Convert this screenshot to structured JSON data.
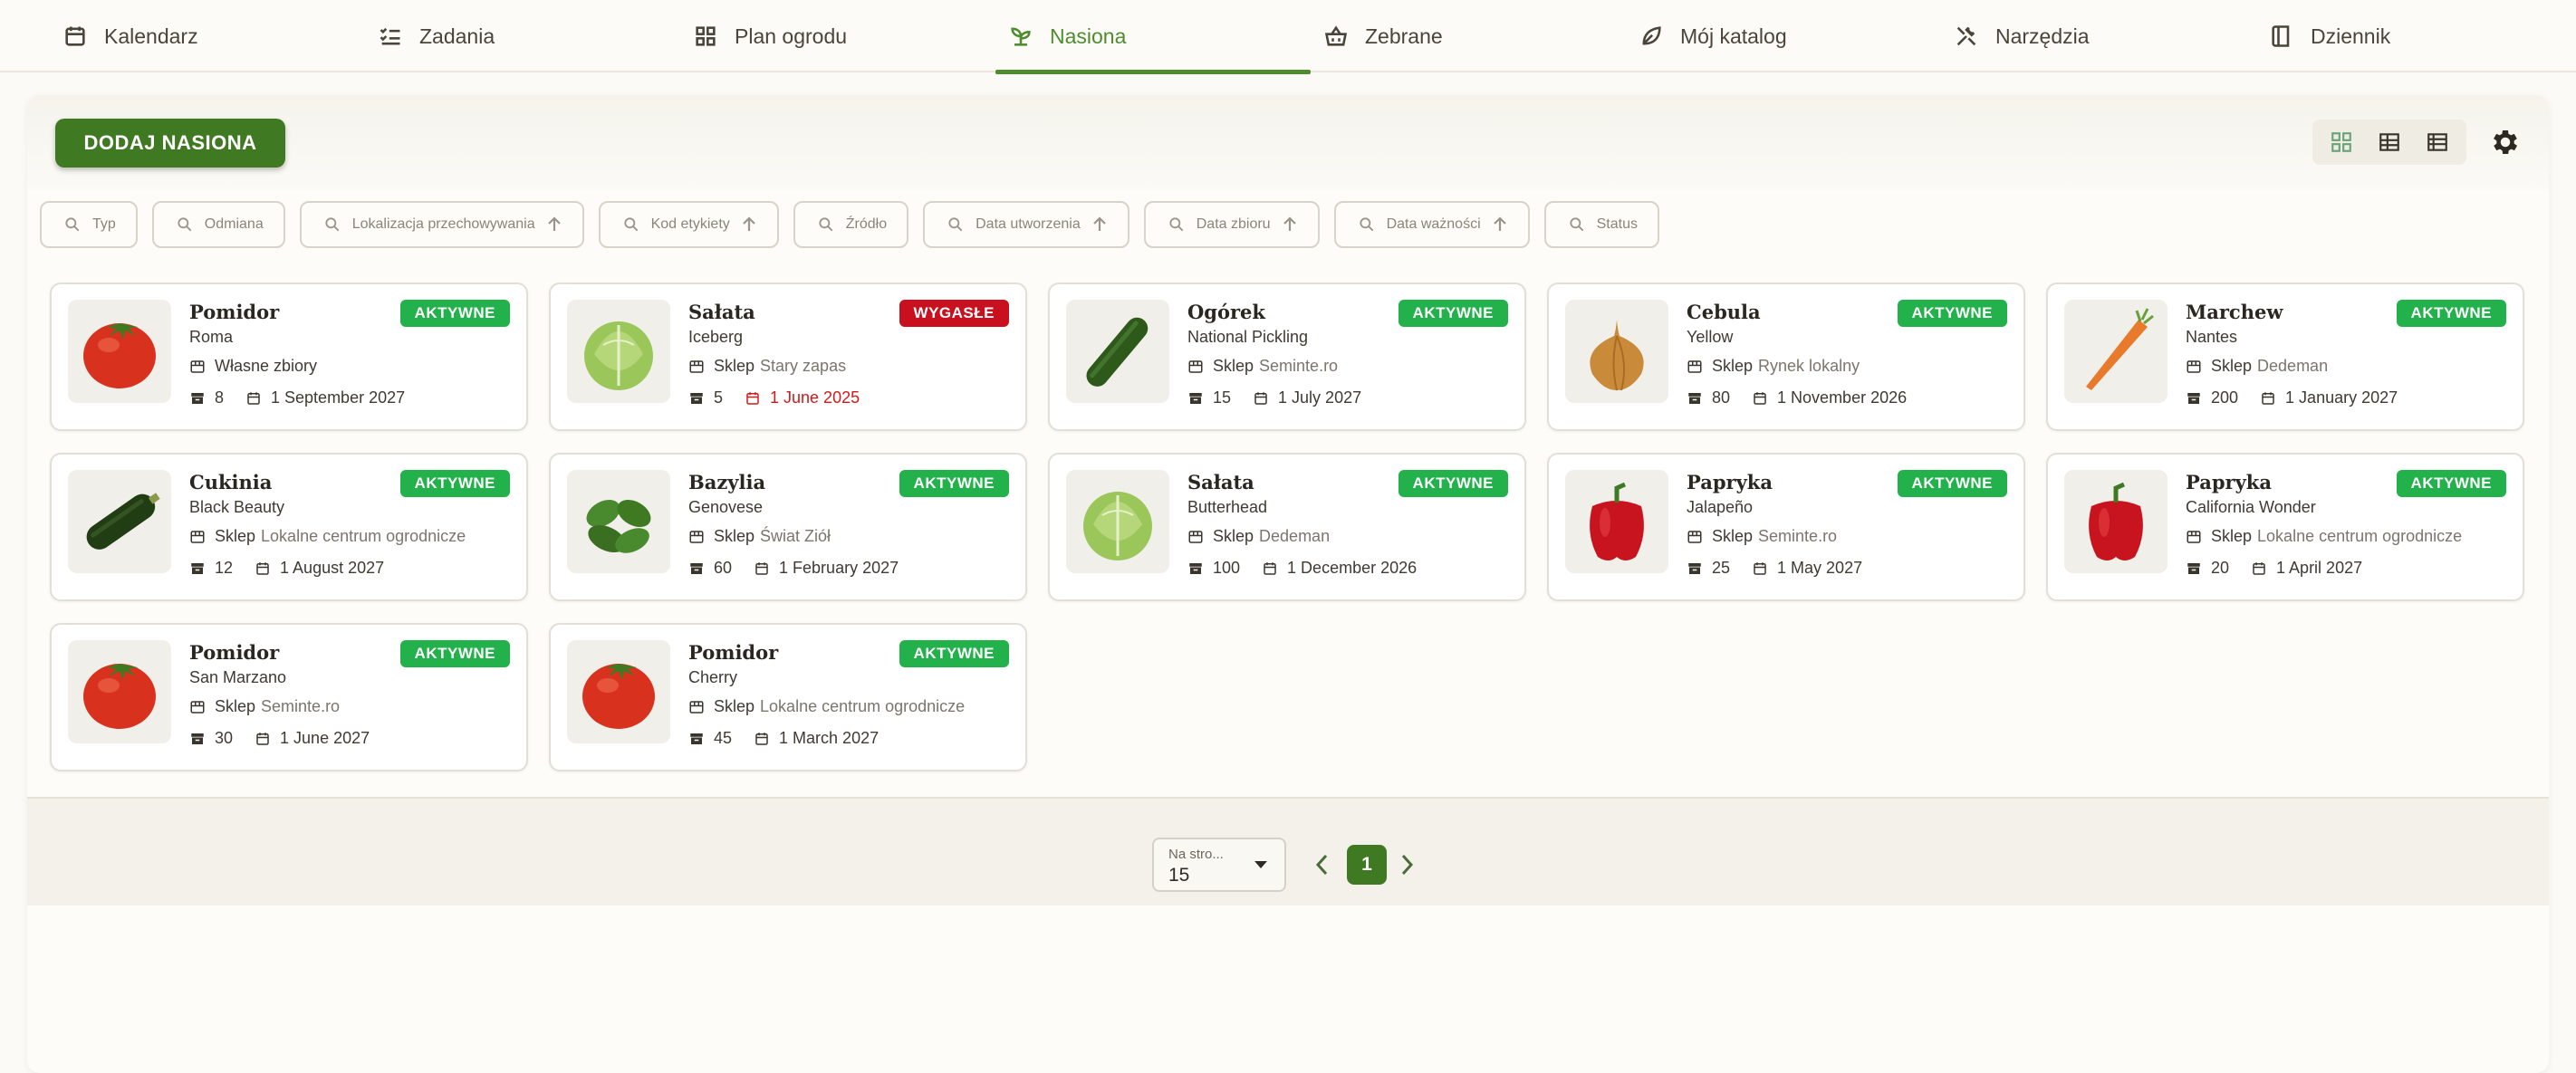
{
  "nav": [
    {
      "label": "Kalendarz",
      "icon": "calendar-icon",
      "active": false
    },
    {
      "label": "Zadania",
      "icon": "checklist-icon",
      "active": false
    },
    {
      "label": "Plan ogrodu",
      "icon": "grid-icon",
      "active": false
    },
    {
      "label": "Nasiona",
      "icon": "sprout-icon",
      "active": true
    },
    {
      "label": "Zebrane",
      "icon": "basket-icon",
      "active": false
    },
    {
      "label": "Mój katalog",
      "icon": "leaf-icon",
      "active": false
    },
    {
      "label": "Narzędzia",
      "icon": "tools-icon",
      "active": false
    },
    {
      "label": "Dziennik",
      "icon": "book-icon",
      "active": false
    }
  ],
  "toolbar": {
    "add_label": "DODAJ NASIONA"
  },
  "filters": [
    {
      "label": "Typ",
      "sortable": false
    },
    {
      "label": "Odmiana",
      "sortable": false
    },
    {
      "label": "Lokalizacja przechowywania",
      "sortable": true
    },
    {
      "label": "Kod etykiety",
      "sortable": true
    },
    {
      "label": "Źródło",
      "sortable": false
    },
    {
      "label": "Data utworzenia",
      "sortable": true
    },
    {
      "label": "Data zbioru",
      "sortable": true
    },
    {
      "label": "Data ważności",
      "sortable": true
    },
    {
      "label": "Status",
      "sortable": false
    }
  ],
  "cards": [
    {
      "name": "Pomidor",
      "variety": "Roma",
      "status": "AKTYWNE",
      "expired": false,
      "source_prefix": "",
      "source": "Własne zbiory",
      "qty": "8",
      "date": "1 September 2027",
      "image": "tomato"
    },
    {
      "name": "Sałata",
      "variety": "Iceberg",
      "status": "WYGASŁE",
      "expired": true,
      "source_prefix": "Sklep",
      "source": "Stary zapas",
      "qty": "5",
      "date": "1 June 2025",
      "image": "lettuce"
    },
    {
      "name": "Ogórek",
      "variety": "National Pickling",
      "status": "AKTYWNE",
      "expired": false,
      "source_prefix": "Sklep",
      "source": "Seminte.ro",
      "qty": "15",
      "date": "1 July 2027",
      "image": "cucumber"
    },
    {
      "name": "Cebula",
      "variety": "Yellow",
      "status": "AKTYWNE",
      "expired": false,
      "source_prefix": "Sklep",
      "source": "Rynek lokalny",
      "qty": "80",
      "date": "1 November 2026",
      "image": "onion"
    },
    {
      "name": "Marchew",
      "variety": "Nantes",
      "status": "AKTYWNE",
      "expired": false,
      "source_prefix": "Sklep",
      "source": "Dedeman",
      "qty": "200",
      "date": "1 January 2027",
      "image": "carrot"
    },
    {
      "name": "Cukinia",
      "variety": "Black Beauty",
      "status": "AKTYWNE",
      "expired": false,
      "source_prefix": "Sklep",
      "source": "Lokalne centrum ogrodnicze",
      "qty": "12",
      "date": "1 August 2027",
      "image": "zucchini"
    },
    {
      "name": "Bazylia",
      "variety": "Genovese",
      "status": "AKTYWNE",
      "expired": false,
      "source_prefix": "Sklep",
      "source": "Świat Ziół",
      "qty": "60",
      "date": "1 February 2027",
      "image": "basil"
    },
    {
      "name": "Sałata",
      "variety": "Butterhead",
      "status": "AKTYWNE",
      "expired": false,
      "source_prefix": "Sklep",
      "source": "Dedeman",
      "qty": "100",
      "date": "1 December 2026",
      "image": "lettuce"
    },
    {
      "name": "Papryka",
      "variety": "Jalapeño",
      "status": "AKTYWNE",
      "expired": false,
      "source_prefix": "Sklep",
      "source": "Seminte.ro",
      "qty": "25",
      "date": "1 May 2027",
      "image": "pepper"
    },
    {
      "name": "Papryka",
      "variety": "California Wonder",
      "status": "AKTYWNE",
      "expired": false,
      "source_prefix": "Sklep",
      "source": "Lokalne centrum ogrodnicze",
      "qty": "20",
      "date": "1 April 2027",
      "image": "pepper"
    },
    {
      "name": "Pomidor",
      "variety": "San Marzano",
      "status": "AKTYWNE",
      "expired": false,
      "source_prefix": "Sklep",
      "source": "Seminte.ro",
      "qty": "30",
      "date": "1 June 2027",
      "image": "tomato"
    },
    {
      "name": "Pomidor",
      "variety": "Cherry",
      "status": "AKTYWNE",
      "expired": false,
      "source_prefix": "Sklep",
      "source": "Lokalne centrum ogrodnicze",
      "qty": "45",
      "date": "1 March 2027",
      "image": "tomato"
    }
  ],
  "pagination": {
    "per_page_label": "Na stro...",
    "per_page_value": "15",
    "current_page": "1"
  },
  "colors": {
    "accent": "#4e8c2e",
    "active_badge": "#22b14a",
    "expired_badge": "#c8101e",
    "expired_date": "#d11a1a"
  }
}
